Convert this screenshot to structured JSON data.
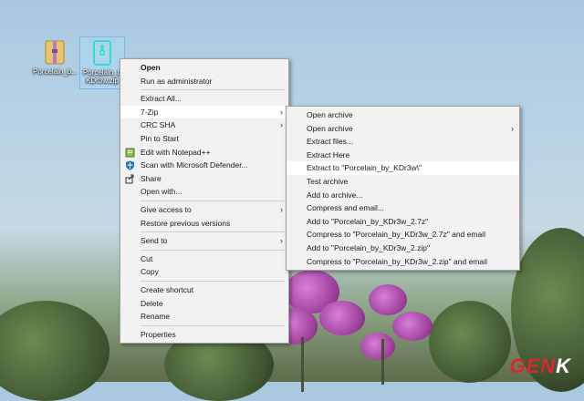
{
  "desktop": {
    "icons": [
      {
        "label": "Porcelain_b...",
        "selected": false
      },
      {
        "label": "Porcelain_b\nKDr3w.zip",
        "selected": true
      }
    ]
  },
  "context_menu": {
    "items": [
      {
        "label": "Open",
        "bold": true
      },
      {
        "label": "Run as administrator"
      },
      {
        "label": "Extract All..."
      },
      {
        "label": "7-Zip",
        "submenu": true,
        "highlighted": true
      },
      {
        "label": "CRC SHA",
        "submenu": true
      },
      {
        "label": "Pin to Start"
      },
      {
        "label": "Edit with Notepad++",
        "icon": "notepad-plus-plus-icon"
      },
      {
        "label": "Scan with Microsoft Defender...",
        "icon": "defender-shield-icon"
      },
      {
        "label": "Share",
        "icon": "share-icon"
      },
      {
        "label": "Open with..."
      },
      {
        "label": "Give access to",
        "submenu": true
      },
      {
        "label": "Restore previous versions"
      },
      {
        "label": "Send to",
        "submenu": true
      },
      {
        "label": "Cut"
      },
      {
        "label": "Copy"
      },
      {
        "label": "Create shortcut"
      },
      {
        "label": "Delete"
      },
      {
        "label": "Rename"
      },
      {
        "label": "Properties"
      }
    ]
  },
  "sevenzip_menu": {
    "items": [
      {
        "label": "Open archive"
      },
      {
        "label": "Open archive",
        "submenu": true
      },
      {
        "label": "Extract files..."
      },
      {
        "label": "Extract Here"
      },
      {
        "label": "Extract to \"Porcelain_by_KDr3w\\\"",
        "highlighted": true
      },
      {
        "label": "Test archive"
      },
      {
        "label": "Add to archive..."
      },
      {
        "label": "Compress and email..."
      },
      {
        "label": "Add to \"Porcelain_by_KDr3w_2.7z\""
      },
      {
        "label": "Compress to \"Porcelain_by_KDr3w_2.7z\" and email"
      },
      {
        "label": "Add to \"Porcelain_by_KDr3w_2.zip\""
      },
      {
        "label": "Compress to \"Porcelain_by_KDr3w_2.zip\" and email"
      }
    ]
  },
  "watermark": {
    "part1": "GEN",
    "part2": "K"
  },
  "colors": {
    "menu_bg": "#f2f2f2",
    "highlight": "#ffffff",
    "accent_zip": "#2de0c6"
  }
}
